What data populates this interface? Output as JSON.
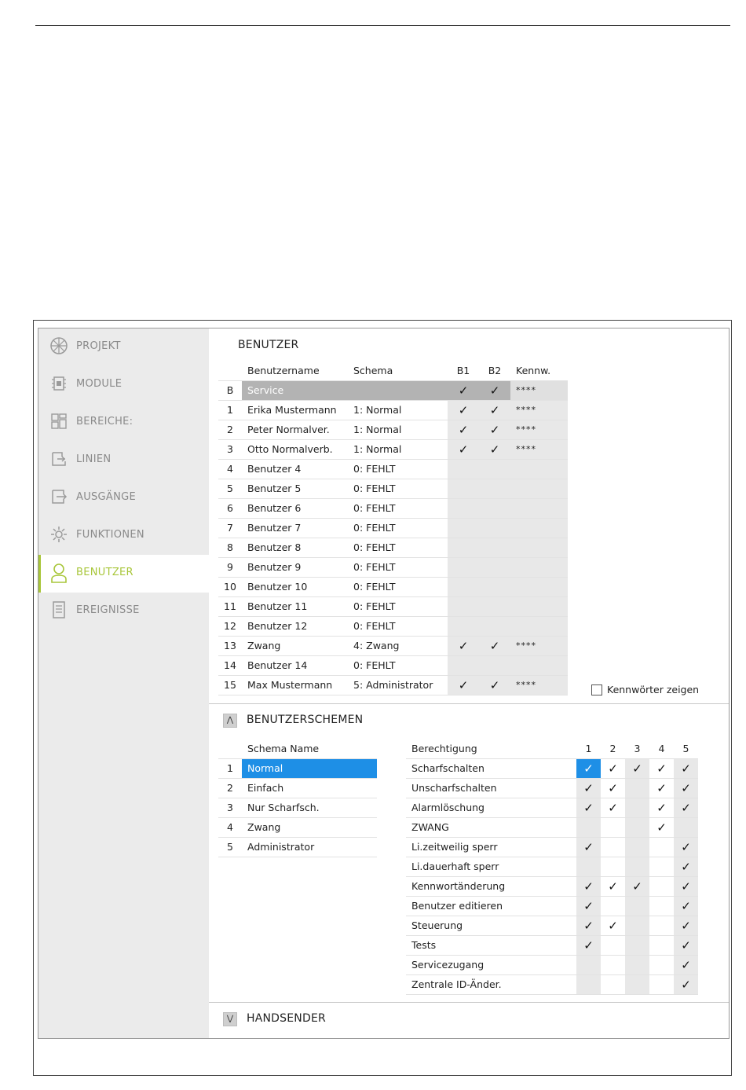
{
  "sidebar": {
    "items": [
      {
        "label": "PROJEKT",
        "icon": "project-icon"
      },
      {
        "label": "MODULE",
        "icon": "module-icon"
      },
      {
        "label": "BEREICHE:",
        "icon": "areas-icon"
      },
      {
        "label": "LINIEN",
        "icon": "lines-icon"
      },
      {
        "label": "AUSGÄNGE",
        "icon": "outputs-icon"
      },
      {
        "label": "FUNKTIONEN",
        "icon": "gear-icon"
      },
      {
        "label": "BENUTZER",
        "icon": "user-icon",
        "active": true
      },
      {
        "label": "EREIGNISSE",
        "icon": "events-icon"
      }
    ],
    "accent_color": "#a8c63a"
  },
  "users": {
    "title": "BENUTZER",
    "headers": [
      "Benutzername",
      "Schema",
      "B1",
      "B2",
      "Kennw."
    ],
    "rows": [
      {
        "num": "B",
        "name": "Service",
        "schema": "",
        "b1": true,
        "b2": true,
        "pw": "****",
        "selected": true
      },
      {
        "num": "1",
        "name": "Erika Mustermann",
        "schema": "1: Normal",
        "b1": true,
        "b2": true,
        "pw": "****"
      },
      {
        "num": "2",
        "name": "Peter Normalver.",
        "schema": "1: Normal",
        "b1": true,
        "b2": true,
        "pw": "****"
      },
      {
        "num": "3",
        "name": "Otto Normalverb.",
        "schema": "1: Normal",
        "b1": true,
        "b2": true,
        "pw": "****"
      },
      {
        "num": "4",
        "name": "Benutzer 4",
        "schema": "0: FEHLT",
        "b1": false,
        "b2": false,
        "pw": ""
      },
      {
        "num": "5",
        "name": "Benutzer 5",
        "schema": "0: FEHLT",
        "b1": false,
        "b2": false,
        "pw": ""
      },
      {
        "num": "6",
        "name": "Benutzer 6",
        "schema": "0: FEHLT",
        "b1": false,
        "b2": false,
        "pw": ""
      },
      {
        "num": "7",
        "name": "Benutzer 7",
        "schema": "0: FEHLT",
        "b1": false,
        "b2": false,
        "pw": ""
      },
      {
        "num": "8",
        "name": "Benutzer 8",
        "schema": "0: FEHLT",
        "b1": false,
        "b2": false,
        "pw": ""
      },
      {
        "num": "9",
        "name": "Benutzer 9",
        "schema": "0: FEHLT",
        "b1": false,
        "b2": false,
        "pw": ""
      },
      {
        "num": "10",
        "name": "Benutzer 10",
        "schema": "0: FEHLT",
        "b1": false,
        "b2": false,
        "pw": ""
      },
      {
        "num": "11",
        "name": "Benutzer 11",
        "schema": "0: FEHLT",
        "b1": false,
        "b2": false,
        "pw": ""
      },
      {
        "num": "12",
        "name": "Benutzer 12",
        "schema": "0: FEHLT",
        "b1": false,
        "b2": false,
        "pw": ""
      },
      {
        "num": "13",
        "name": "Zwang",
        "schema": "4: Zwang",
        "b1": true,
        "b2": true,
        "pw": "****"
      },
      {
        "num": "14",
        "name": "Benutzer 14",
        "schema": "0: FEHLT",
        "b1": false,
        "b2": false,
        "pw": ""
      },
      {
        "num": "15",
        "name": "Max Mustermann",
        "schema": "5: Administrator",
        "b1": true,
        "b2": true,
        "pw": "****"
      }
    ],
    "show_passwords_label": "Kennwörter zeigen",
    "show_passwords_checked": false
  },
  "schemes": {
    "title": "BENUTZERSCHEMEN",
    "toggle_icon": "⋀",
    "name_header": "Schema Name",
    "rows": [
      {
        "num": "1",
        "name": "Normal",
        "selected": true
      },
      {
        "num": "2",
        "name": "Einfach"
      },
      {
        "num": "3",
        "name": "Nur Scharfsch."
      },
      {
        "num": "4",
        "name": "Zwang"
      },
      {
        "num": "5",
        "name": "Administrator"
      }
    ],
    "perm_header": "Berechtigung",
    "col_headers": [
      "1",
      "2",
      "3",
      "4",
      "5"
    ],
    "permissions": [
      {
        "label": "Scharfschalten",
        "checks": [
          true,
          true,
          true,
          true,
          true
        ]
      },
      {
        "label": "Unscharfschalten",
        "checks": [
          true,
          true,
          false,
          true,
          true
        ]
      },
      {
        "label": "Alarmlöschung",
        "checks": [
          true,
          true,
          false,
          true,
          true
        ]
      },
      {
        "label": "ZWANG",
        "checks": [
          false,
          false,
          false,
          true,
          false
        ]
      },
      {
        "label": "Li.zeitweilig sperr",
        "checks": [
          true,
          false,
          false,
          false,
          true
        ]
      },
      {
        "label": "Li.dauerhaft sperr",
        "checks": [
          false,
          false,
          false,
          false,
          true
        ]
      },
      {
        "label": "Kennwortänderung",
        "checks": [
          true,
          true,
          true,
          false,
          true
        ]
      },
      {
        "label": "Benutzer editieren",
        "checks": [
          true,
          false,
          false,
          false,
          true
        ]
      },
      {
        "label": "Steuerung",
        "checks": [
          true,
          true,
          false,
          false,
          true
        ]
      },
      {
        "label": "Tests",
        "checks": [
          true,
          false,
          false,
          false,
          true
        ]
      },
      {
        "label": "Servicezugang",
        "checks": [
          false,
          false,
          false,
          false,
          true
        ]
      },
      {
        "label": "Zentrale ID-Änder.",
        "checks": [
          false,
          false,
          false,
          false,
          true
        ]
      }
    ]
  },
  "handsender": {
    "title": "HANDSENDER",
    "toggle_icon": "⋁"
  },
  "check_glyph": "✓",
  "selection_color": "#1e8fe6"
}
